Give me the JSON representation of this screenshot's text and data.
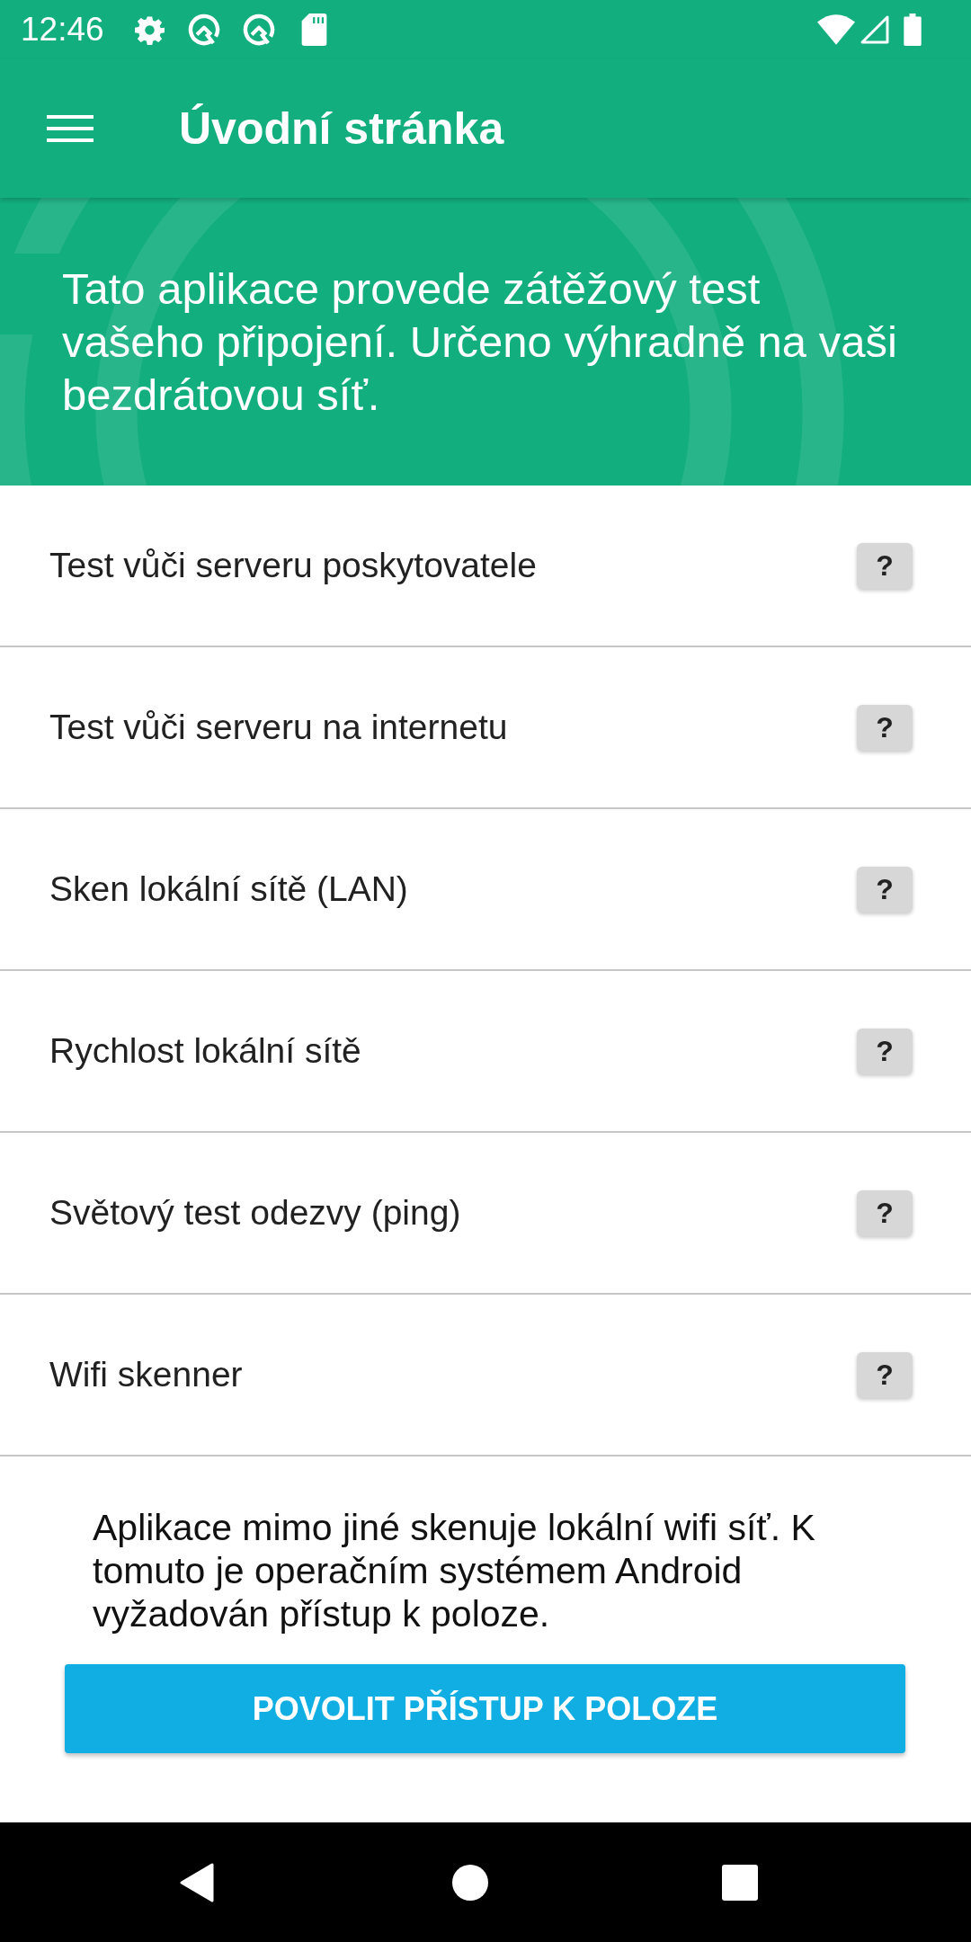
{
  "status_bar": {
    "time": "12:46"
  },
  "app_bar": {
    "title": "Úvodní stránka"
  },
  "banner": {
    "text": "Tato aplikace provede zátěžový test vašeho připojení. Určeno výhradně na vaši bezdrátovou síť."
  },
  "menu_items": [
    {
      "label": "Test vůči serveru poskytovatele",
      "help": "?"
    },
    {
      "label": "Test vůči serveru na internetu",
      "help": "?"
    },
    {
      "label": "Sken lokální sítě (LAN)",
      "help": "?"
    },
    {
      "label": "Rychlost lokální sítě",
      "help": "?"
    },
    {
      "label": "Světový test odezvy (ping)",
      "help": "?"
    },
    {
      "label": "Wifi skenner",
      "help": "?"
    }
  ],
  "notice": {
    "text": "Aplikace mimo jiné skenuje lokální wifi síť. K tomuto je operačním systémem Android vyžadován přístup k poloze.",
    "button": "POVOLIT PŘÍSTUP K POLOZE"
  }
}
